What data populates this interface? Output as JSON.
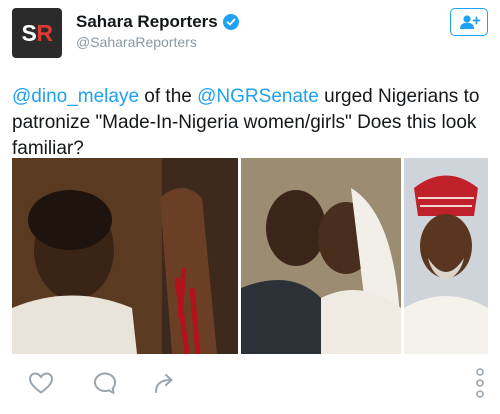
{
  "header": {
    "avatar_letters_left": "S",
    "avatar_letters_right": "R",
    "display_name": "Sahara Reporters",
    "handle": "@SaharaReporters",
    "verified": true,
    "follow_icon": "add-user-icon"
  },
  "tweet": {
    "mention_1": "@dino_melaye",
    "text_1": " of the ",
    "mention_2": "@NGRSenate",
    "text_2": " urged Nigerians to patronize \"Made-In-Nigeria women/girls\" Does this look familiar?"
  },
  "media": {
    "count": 3
  },
  "actions": {
    "icons": [
      "heart-icon",
      "reply-icon",
      "share-icon",
      "more-options-icon"
    ]
  },
  "colors": {
    "accent": "#1da1f2",
    "text": "#14171a",
    "muted": "#8899a6",
    "avatar_bg": "#2b2b2b",
    "avatar_red": "#e03a2f"
  }
}
